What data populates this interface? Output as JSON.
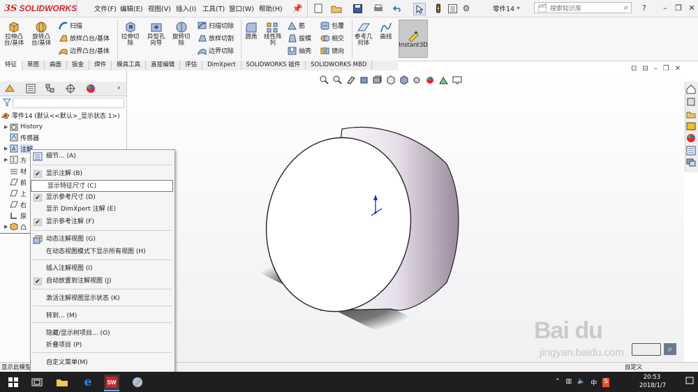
{
  "app": {
    "logo_ds": "3S",
    "logo_name": "SOLIDWORKS",
    "doc_title": "零件14 *"
  },
  "menubar": [
    "文件(F)",
    "编辑(E)",
    "视图(V)",
    "插入(I)",
    "工具(T)",
    "窗口(W)",
    "帮助(H)"
  ],
  "search": {
    "placeholder": "搜索知识库"
  },
  "ribbon": {
    "extrude_boss": "拉伸凸\n台/基体",
    "revolve_boss": "旋转凸\n台/基体",
    "sweep": "扫描",
    "loft_boss": "放样凸台/基体",
    "boundary_boss": "边界凸台/基体",
    "extrude_cut": "拉伸切\n除",
    "hole_wizard": "异型孔\n向导",
    "revolve_cut": "旋转切\n除",
    "sweep_cut": "扫描切除",
    "loft_cut": "放样切割",
    "boundary_cut": "边界切除",
    "fillet": "圆角",
    "linear_pattern": "线性阵\n列",
    "rib": "筋",
    "draft": "拔模",
    "shell": "抽壳",
    "wrap": "包覆",
    "intersect": "相交",
    "mirror": "镜向",
    "ref_geometry": "参考几\n何体",
    "curves": "曲线",
    "instant3d": "Instant3D"
  },
  "tabs": [
    "特征",
    "草图",
    "曲面",
    "钣金",
    "焊件",
    "模具工具",
    "直接编辑",
    "评估",
    "DimXpert",
    "SOLIDWORKS 插件",
    "SOLIDWORKS MBD"
  ],
  "tree": {
    "root": "零件14  (默认<<默认>_显示状态 1>)",
    "items": [
      "History",
      "传感器",
      "注解",
      "方",
      "材",
      "前",
      "上",
      "右",
      "原",
      "凸"
    ]
  },
  "context_menu": {
    "items": [
      {
        "label": "细节... (A)",
        "checked": false,
        "icon": "details-icon"
      },
      {
        "label": "显示注解 (B)",
        "checked": true
      },
      {
        "label": "显示特征尺寸 (C)",
        "checked": false,
        "highlighted": true
      },
      {
        "label": "显示参考尺寸 (D)",
        "checked": true
      },
      {
        "label": "显示 DimXpert 注解 (E)",
        "checked": false
      },
      {
        "label": "显示参考注解 (F)",
        "checked": true
      },
      {
        "label": "动态注解视图 (G)",
        "checked": false,
        "icon": "dynamic-view-icon"
      },
      {
        "label": "在动态视图模式下显示所有视图 (H)",
        "checked": false
      },
      {
        "label": "插入注解视图 (I)",
        "checked": false
      },
      {
        "label": "自动放置到注解视图 (J)",
        "checked": true
      },
      {
        "label": "激活注解视图显示状态 (K)",
        "checked": false
      },
      {
        "label": "转到... (M)",
        "checked": false
      },
      {
        "label": "隐藏/显示树项目... (O)",
        "checked": false
      },
      {
        "label": "折叠项目 (P)",
        "checked": false
      },
      {
        "label": "自定义菜单(M)",
        "checked": false
      }
    ],
    "check_glyph": "✔"
  },
  "statusbar": {
    "left": "显示此模型",
    "right": "自定义"
  },
  "taskbar": {
    "time": "20:53",
    "date": "2018/1/7",
    "ime": "中"
  },
  "watermark": {
    "brand": "Bai du",
    "url": "jingyan.baidu.com"
  }
}
